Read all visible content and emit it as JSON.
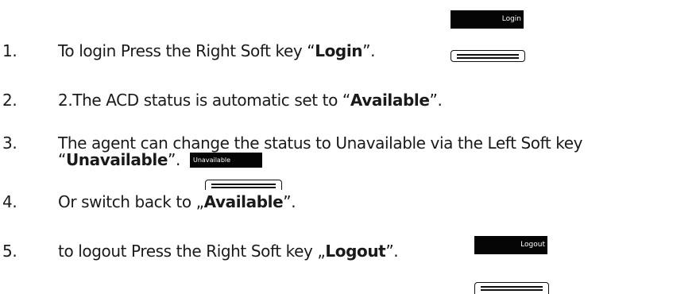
{
  "steps": [
    {
      "number": "1.",
      "before": "To login Press the Right Soft key “",
      "bold": "Login",
      "after": "”."
    },
    {
      "number": "2.",
      "before": "2.The ACD status is automatic set to “",
      "bold": "Available",
      "after": "”."
    },
    {
      "number": "3.",
      "line1": "The agent can change the status to Unavailable via the Left Soft key",
      "before": "“",
      "bold": "Unavailable",
      "after": "”."
    },
    {
      "number": "4.",
      "before": "Or switch back to „",
      "bold": "Available",
      "after": "”."
    },
    {
      "number": "5.",
      "before": "to logout Press the Right Soft key „",
      "bold": "Logout",
      "after": "”."
    }
  ],
  "softkeys": {
    "login": "Login",
    "unavailable": "Unavailable",
    "logout": "Logout"
  }
}
